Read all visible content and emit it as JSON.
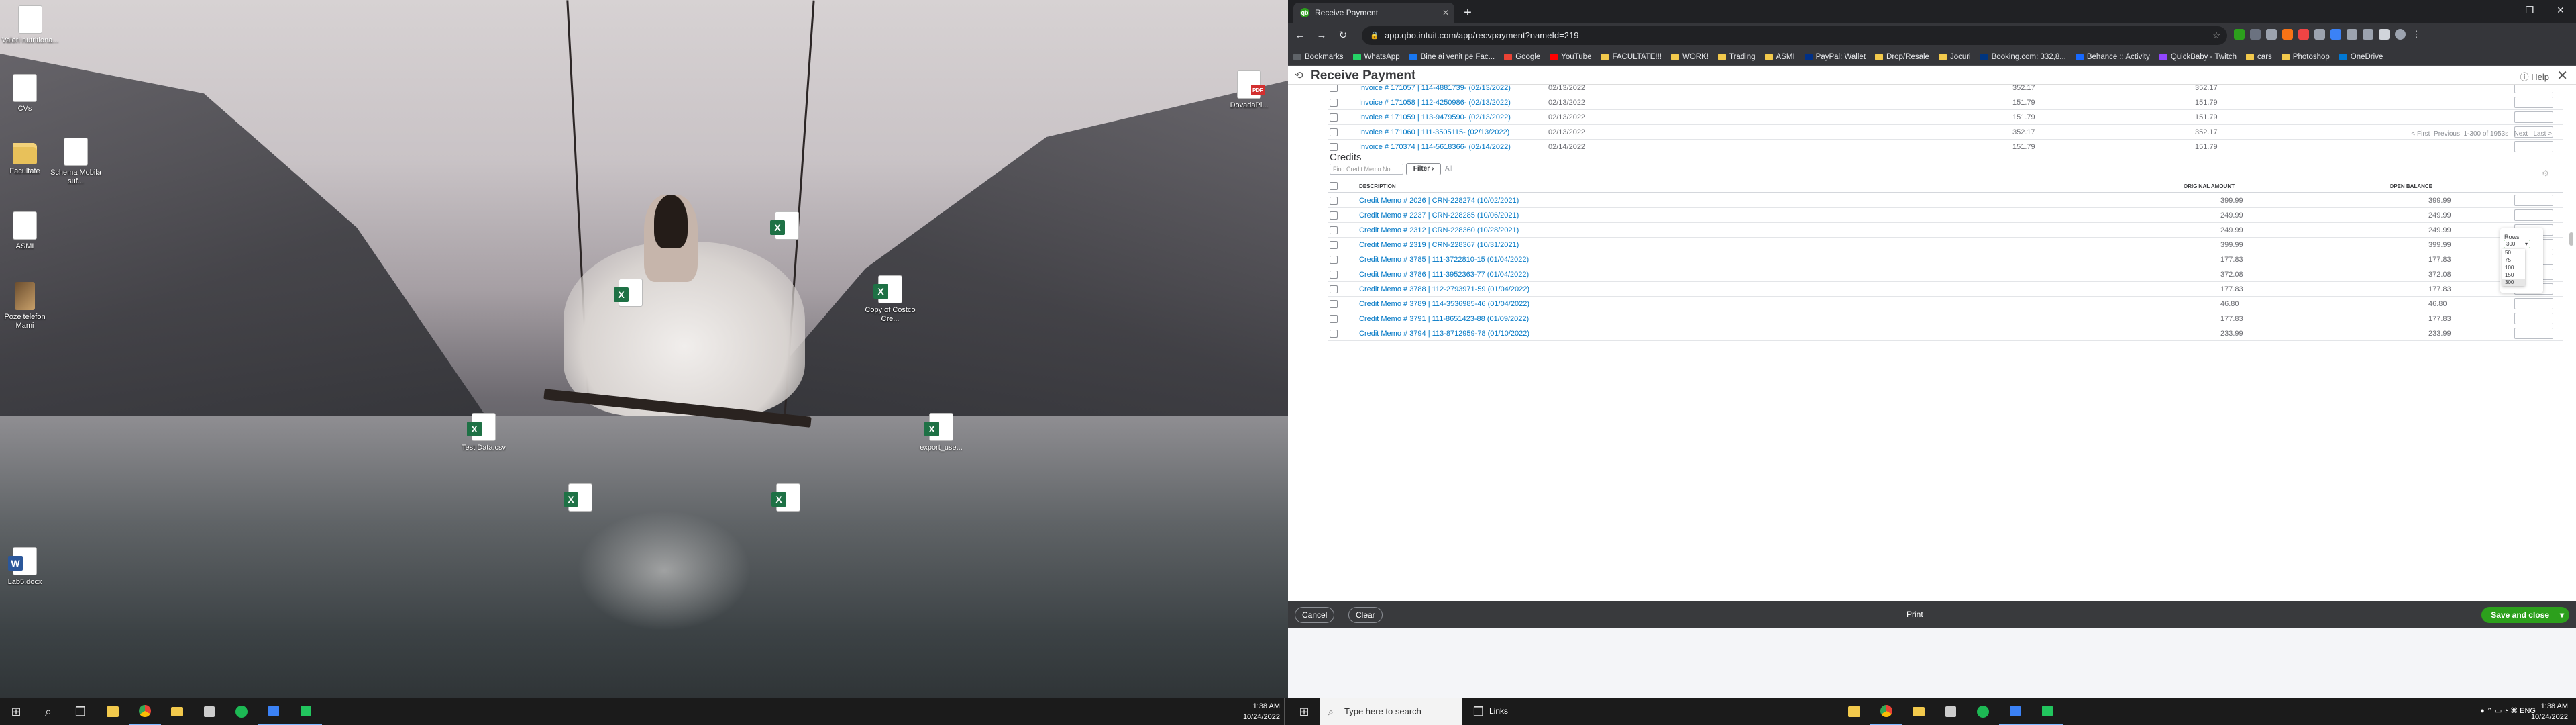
{
  "desktop": {
    "icons": [
      {
        "label": "Valori nutritiona...",
        "type": "doc"
      },
      {
        "label": "CVs",
        "type": "doc"
      },
      {
        "label": "Facultate",
        "type": "folder"
      },
      {
        "label": "Schema Mobila suf...",
        "type": "doc"
      },
      {
        "label": "ASMI",
        "type": "doc"
      },
      {
        "label": "Poze telefon Mami",
        "type": "photo"
      },
      {
        "label": "Lab5.docx",
        "type": "word"
      },
      {
        "label": "DovadaPl...",
        "type": "pdf"
      },
      {
        "label": "Copy of Costco Cre...",
        "type": "xls"
      },
      {
        "label": "Test Data.csv",
        "type": "xls"
      },
      {
        "label": "export_use...",
        "type": "xls"
      }
    ]
  },
  "taskbar_left": {
    "time": "1:38 AM",
    "date": "10/24/2022"
  },
  "browser": {
    "tab_title": "Receive Payment",
    "url": "app.qbo.intuit.com/app/recvpayment?nameId=219",
    "bookmarks": [
      {
        "label": "Bookmarks",
        "color": "#5f6368"
      },
      {
        "label": "WhatsApp",
        "color": "#25d366"
      },
      {
        "label": "Bine ai venit pe Fac...",
        "color": "#1877f2"
      },
      {
        "label": "Google",
        "color": "#ea4335"
      },
      {
        "label": "YouTube",
        "color": "#ff0000"
      },
      {
        "label": "FACULTATE!!!",
        "color": "#f2c94c"
      },
      {
        "label": "WORK!",
        "color": "#f2c94c"
      },
      {
        "label": "Trading",
        "color": "#f2c94c"
      },
      {
        "label": "ASMI",
        "color": "#f2c94c"
      },
      {
        "label": "PayPal: Wallet",
        "color": "#003087"
      },
      {
        "label": "Drop/Resale",
        "color": "#f2c94c"
      },
      {
        "label": "Jocuri",
        "color": "#f2c94c"
      },
      {
        "label": "Booking.com: 332,8...",
        "color": "#003580"
      },
      {
        "label": "Behance :: Activity",
        "color": "#1769ff"
      },
      {
        "label": "QuickBaby - Twitch",
        "color": "#9146ff"
      },
      {
        "label": "cars",
        "color": "#f2c94c"
      },
      {
        "label": "Photoshop",
        "color": "#f2c94c"
      },
      {
        "label": "OneDrive",
        "color": "#0078d4"
      }
    ]
  },
  "qbo": {
    "title": "Receive Payment",
    "help_label": "Help",
    "invoices": [
      {
        "desc": "Invoice # 171057 | 114-4881739- (02/13/2022)",
        "date": "02/13/2022",
        "original": "352.17",
        "open": "352.17"
      },
      {
        "desc": "Invoice # 171058 | 112-4250986- (02/13/2022)",
        "date": "02/13/2022",
        "original": "151.79",
        "open": "151.79"
      },
      {
        "desc": "Invoice # 171059 | 113-9479590- (02/13/2022)",
        "date": "02/13/2022",
        "original": "151.79",
        "open": "151.79"
      },
      {
        "desc": "Invoice # 171060 | 111-3505115- (02/13/2022)",
        "date": "02/13/2022",
        "original": "352.17",
        "open": "352.17"
      },
      {
        "desc": "Invoice # 170374 | 114-5618366- (02/14/2022)",
        "date": "02/14/2022",
        "original": "151.79",
        "open": "151.79"
      }
    ],
    "pager": {
      "first": "< First",
      "previous": "Previous",
      "range": "1-300 of 1953s",
      "next": "Next",
      "last": "Last >"
    },
    "credits": {
      "title": "Credits",
      "find_placeholder": "Find Credit Memo No.",
      "filter_label": "Filter",
      "all_label": "All",
      "headers": {
        "description": "DESCRIPTION",
        "original": "ORIGINAL AMOUNT",
        "open": "OPEN BALANCE"
      },
      "rows": [
        {
          "desc": "Credit Memo # 2026 | CRN-228274 (10/02/2021)",
          "original": "399.99",
          "open": "399.99"
        },
        {
          "desc": "Credit Memo # 2237 | CRN-228285 (10/06/2021)",
          "original": "249.99",
          "open": "249.99"
        },
        {
          "desc": "Credit Memo # 2312 | CRN-228360 (10/28/2021)",
          "original": "249.99",
          "open": "249.99"
        },
        {
          "desc": "Credit Memo # 2319 | CRN-228367 (10/31/2021)",
          "original": "399.99",
          "open": "399.99"
        },
        {
          "desc": "Credit Memo # 3785 | 111-3722810-15 (01/04/2022)",
          "original": "177.83",
          "open": "177.83"
        },
        {
          "desc": "Credit Memo # 3786 | 111-3952363-77 (01/04/2022)",
          "original": "372.08",
          "open": "372.08"
        },
        {
          "desc": "Credit Memo # 3788 | 112-2793971-59 (01/04/2022)",
          "original": "177.83",
          "open": "177.83"
        },
        {
          "desc": "Credit Memo # 3789 | 114-3536985-46 (01/04/2022)",
          "original": "46.80",
          "open": "46.80"
        },
        {
          "desc": "Credit Memo # 3791 | 111-8651423-88 (01/09/2022)",
          "original": "177.83",
          "open": "177.83"
        },
        {
          "desc": "Credit Memo # 3794 | 113-8712959-78 (01/10/2022)",
          "original": "233.99",
          "open": "233.99"
        }
      ]
    },
    "rows_popup": {
      "label": "Rows",
      "selected": "300",
      "options": [
        "50",
        "75",
        "100",
        "150",
        "300"
      ]
    },
    "footer": {
      "cancel": "Cancel",
      "clear": "Clear",
      "print": "Print",
      "save": "Save and close"
    }
  },
  "taskbar_right": {
    "search_placeholder": "Type here to search",
    "links_label": "Links",
    "lang": "ENG",
    "time": "1:38 AM",
    "date": "10/24/2022"
  }
}
